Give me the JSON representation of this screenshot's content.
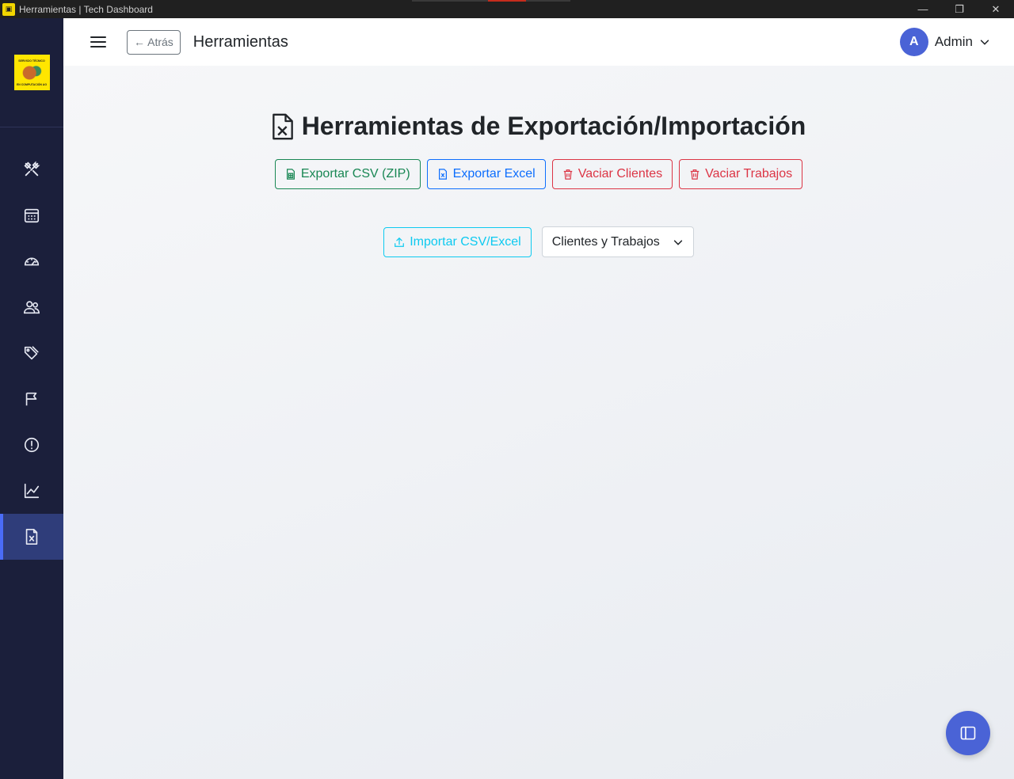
{
  "window": {
    "title": "Herramientas | Tech Dashboard",
    "minimize_glyph": "—",
    "restore_glyph": "❐",
    "close_glyph": "✕"
  },
  "sidebar": {
    "logo": {
      "top_text": "SERVICIO TÉCNICO",
      "bottom_text": "EN COMPUTACIÓN AG"
    },
    "items": [
      {
        "icon": "tools-icon"
      },
      {
        "icon": "calendar-icon"
      },
      {
        "icon": "speedometer-icon"
      },
      {
        "icon": "people-icon"
      },
      {
        "icon": "tags-icon"
      },
      {
        "icon": "flag-icon"
      },
      {
        "icon": "alert-icon"
      },
      {
        "icon": "chart-line-icon"
      },
      {
        "icon": "file-excel-icon",
        "active": true
      }
    ]
  },
  "header": {
    "back_label": "← Atrás",
    "title": "Herramientas",
    "user": {
      "initial": "A",
      "name": "Admin"
    }
  },
  "main": {
    "title": "Herramientas de Exportación/Importación",
    "actions": [
      {
        "label": "Exportar CSV (ZIP)",
        "icon": "file-spreadsheet-icon",
        "variant": "green"
      },
      {
        "label": "Exportar Excel",
        "icon": "file-excel-icon",
        "variant": "blue"
      },
      {
        "label": "Vaciar Clientes",
        "icon": "trash-icon",
        "variant": "red"
      },
      {
        "label": "Vaciar Trabajos",
        "icon": "trash-icon",
        "variant": "red"
      }
    ],
    "import": {
      "button_label": "Importar CSV/Excel",
      "select_value": "Clientes y Trabajos"
    }
  },
  "colors": {
    "sidebar_bg": "#1b1f3b",
    "accent": "#4a63d6",
    "green": "#198754",
    "blue": "#0d6efd",
    "red": "#dc3545",
    "cyan": "#0dcaf0"
  }
}
